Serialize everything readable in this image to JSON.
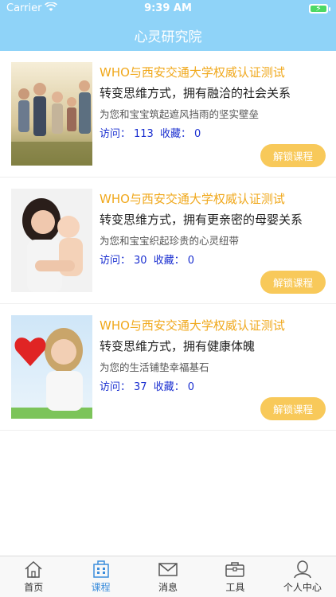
{
  "status": {
    "carrier": "Carrier",
    "time": "9:39 AM"
  },
  "nav": {
    "title": "心灵研究院"
  },
  "courses": [
    {
      "title": "WHO与西安交通大学权威认证测试",
      "subtitle": "转变思维方式，拥有融洽的社会关系",
      "desc": "为您和宝宝筑起遮风挡雨的坚实壁垒",
      "visits_label": "访问：",
      "visits": "113",
      "favorites_label": "收藏：",
      "favorites": "0",
      "button": "解锁课程"
    },
    {
      "title": "WHO与西安交通大学权威认证测试",
      "subtitle": "转变思维方式，拥有更亲密的母婴关系",
      "desc": "为您和宝宝织起珍贵的心灵纽带",
      "visits_label": "访问：",
      "visits": "30",
      "favorites_label": "收藏：",
      "favorites": "0",
      "button": "解锁课程"
    },
    {
      "title": "WHO与西安交通大学权威认证测试",
      "subtitle": "转变思维方式，拥有健康体魄",
      "desc": "为您的生活铺垫幸福基石",
      "visits_label": "访问：",
      "visits": "37",
      "favorites_label": "收藏：",
      "favorites": "0",
      "button": "解锁课程"
    }
  ],
  "tabs": [
    {
      "label": "首页",
      "icon": "home-icon"
    },
    {
      "label": "课程",
      "icon": "building-icon",
      "active": true
    },
    {
      "label": "消息",
      "icon": "mail-icon"
    },
    {
      "label": "工具",
      "icon": "toolbox-icon"
    },
    {
      "label": "个人中心",
      "icon": "user-icon"
    }
  ],
  "colors": {
    "header": "#8fd3f8",
    "title": "#f0a81c",
    "stats": "#1a2fd0",
    "button": "#f8c95a",
    "active_tab": "#3b8ddc"
  }
}
